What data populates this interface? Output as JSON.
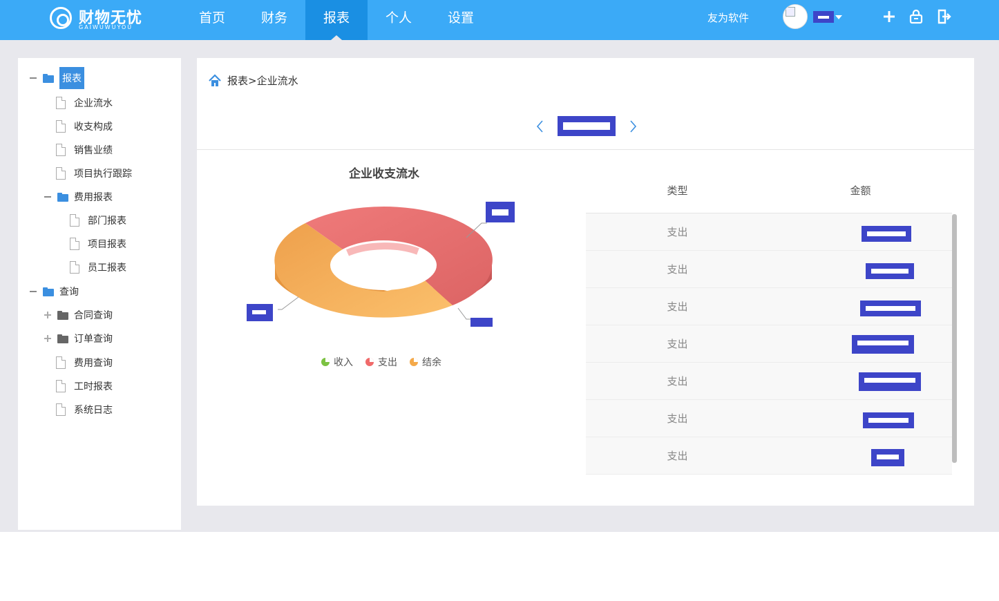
{
  "header": {
    "logo_text": "财物无忧",
    "logo_sub": "GAIWUWUYOU",
    "nav": [
      {
        "label": "首页",
        "active": false
      },
      {
        "label": "财务",
        "active": false
      },
      {
        "label": "报表",
        "active": true
      },
      {
        "label": "个人",
        "active": false
      },
      {
        "label": "设置",
        "active": false
      }
    ],
    "company": "友为软件",
    "user_name": "****",
    "icons": [
      "plus-icon",
      "lock-icon",
      "logout-icon"
    ],
    "accent": "#3baaf7"
  },
  "sidebar": {
    "items": [
      {
        "label": "报表",
        "kind": "folder",
        "toggle": "minus",
        "selected": true
      },
      {
        "label": "企业流水",
        "kind": "file"
      },
      {
        "label": "收支构成",
        "kind": "file"
      },
      {
        "label": "销售业绩",
        "kind": "file"
      },
      {
        "label": "项目执行跟踪",
        "kind": "file"
      },
      {
        "label": "费用报表",
        "kind": "folder",
        "toggle": "minus"
      },
      {
        "label": "部门报表",
        "kind": "file"
      },
      {
        "label": "项目报表",
        "kind": "file"
      },
      {
        "label": "员工报表",
        "kind": "file"
      },
      {
        "label": "查询",
        "kind": "folder",
        "toggle": "minus"
      },
      {
        "label": "合同查询",
        "kind": "folder",
        "toggle": "plus"
      },
      {
        "label": "订单查询",
        "kind": "folder",
        "toggle": "plus"
      },
      {
        "label": "费用查询",
        "kind": "file"
      },
      {
        "label": "工时报表",
        "kind": "file"
      },
      {
        "label": "系统日志",
        "kind": "file"
      }
    ]
  },
  "main": {
    "breadcrumb": "报表>企业流水",
    "period_label": "",
    "chart": {
      "title": "企业收支流水",
      "legend": [
        {
          "label": "收入",
          "color": "#7cc242"
        },
        {
          "label": "支出",
          "color": "#f06a6a"
        },
        {
          "label": "结余",
          "color": "#f4a94a"
        }
      ],
      "slice_colors": {
        "支出": "#e86e6e",
        "结余": "#f4b060"
      }
    },
    "table": {
      "headers": [
        "类型",
        "金额"
      ],
      "rows": [
        {
          "type": "支出",
          "amount": ""
        },
        {
          "type": "支出",
          "amount": ""
        },
        {
          "type": "支出",
          "amount": ""
        },
        {
          "type": "支出",
          "amount": ""
        },
        {
          "type": "支出",
          "amount": ""
        },
        {
          "type": "支出",
          "amount": ""
        },
        {
          "type": "支出",
          "amount": ""
        }
      ]
    },
    "redaction_color": "#3d45c8"
  }
}
